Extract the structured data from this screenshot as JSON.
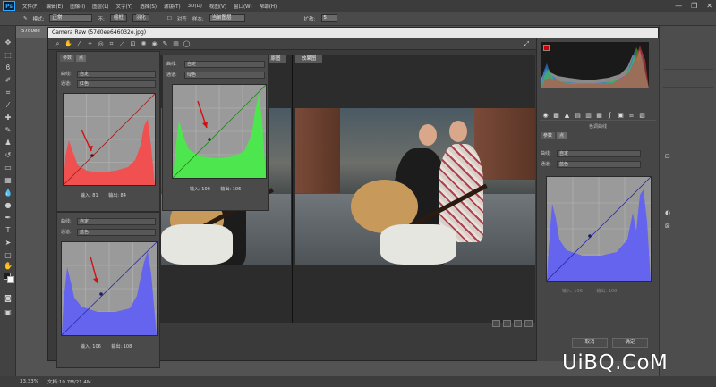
{
  "app": {
    "logo": "Ps"
  },
  "menu": [
    "文件(F)",
    "编辑(E)",
    "图像(I)",
    "图层(L)",
    "文字(Y)",
    "选择(S)",
    "滤镜(T)",
    "3D(D)",
    "视图(V)",
    "窗口(W)",
    "帮助(H)"
  ],
  "window_controls": {
    "minimize": "—",
    "restore": "❐",
    "close": "✕"
  },
  "options": {
    "mode_label": "模式:",
    "mode_value": "正常",
    "style_label": "不:",
    "btn1": "缩框",
    "btn2": "羽化",
    "align_label": "对齐",
    "sample_label": "样本:",
    "sample_value": "当前图层",
    "diffuse_label": "扩散:",
    "diffuse_value": "5"
  },
  "document": {
    "tab_title": "57d0ee"
  },
  "camera_raw": {
    "title": "Camera Raw (57d0ee646032e.jpg)",
    "before_label": "原图",
    "after_label": "效果图",
    "cancel": "取消",
    "ok": "确定"
  },
  "curves": {
    "tab_params": "参数",
    "tab_point": "点",
    "curve_label": "曲线:",
    "curve_value": "自定",
    "channel_label": "通道:",
    "input_label": "输入:",
    "output_label": "输出:",
    "red": {
      "channel": "红色",
      "input": "81",
      "output": "84",
      "color": "#f04a4a"
    },
    "green": {
      "channel": "绿色",
      "input": "100",
      "output": "106",
      "color": "#4ee64e"
    },
    "blue": {
      "channel": "蓝色",
      "input": "106",
      "output": "108",
      "color": "#5a5aee"
    },
    "right_panel_title": "色调曲线",
    "right_channel": "蓝色"
  },
  "status": {
    "zoom": "33.33%",
    "doc": "文档:10.7M/21.4M"
  },
  "watermark": "UiBQ.CoM"
}
